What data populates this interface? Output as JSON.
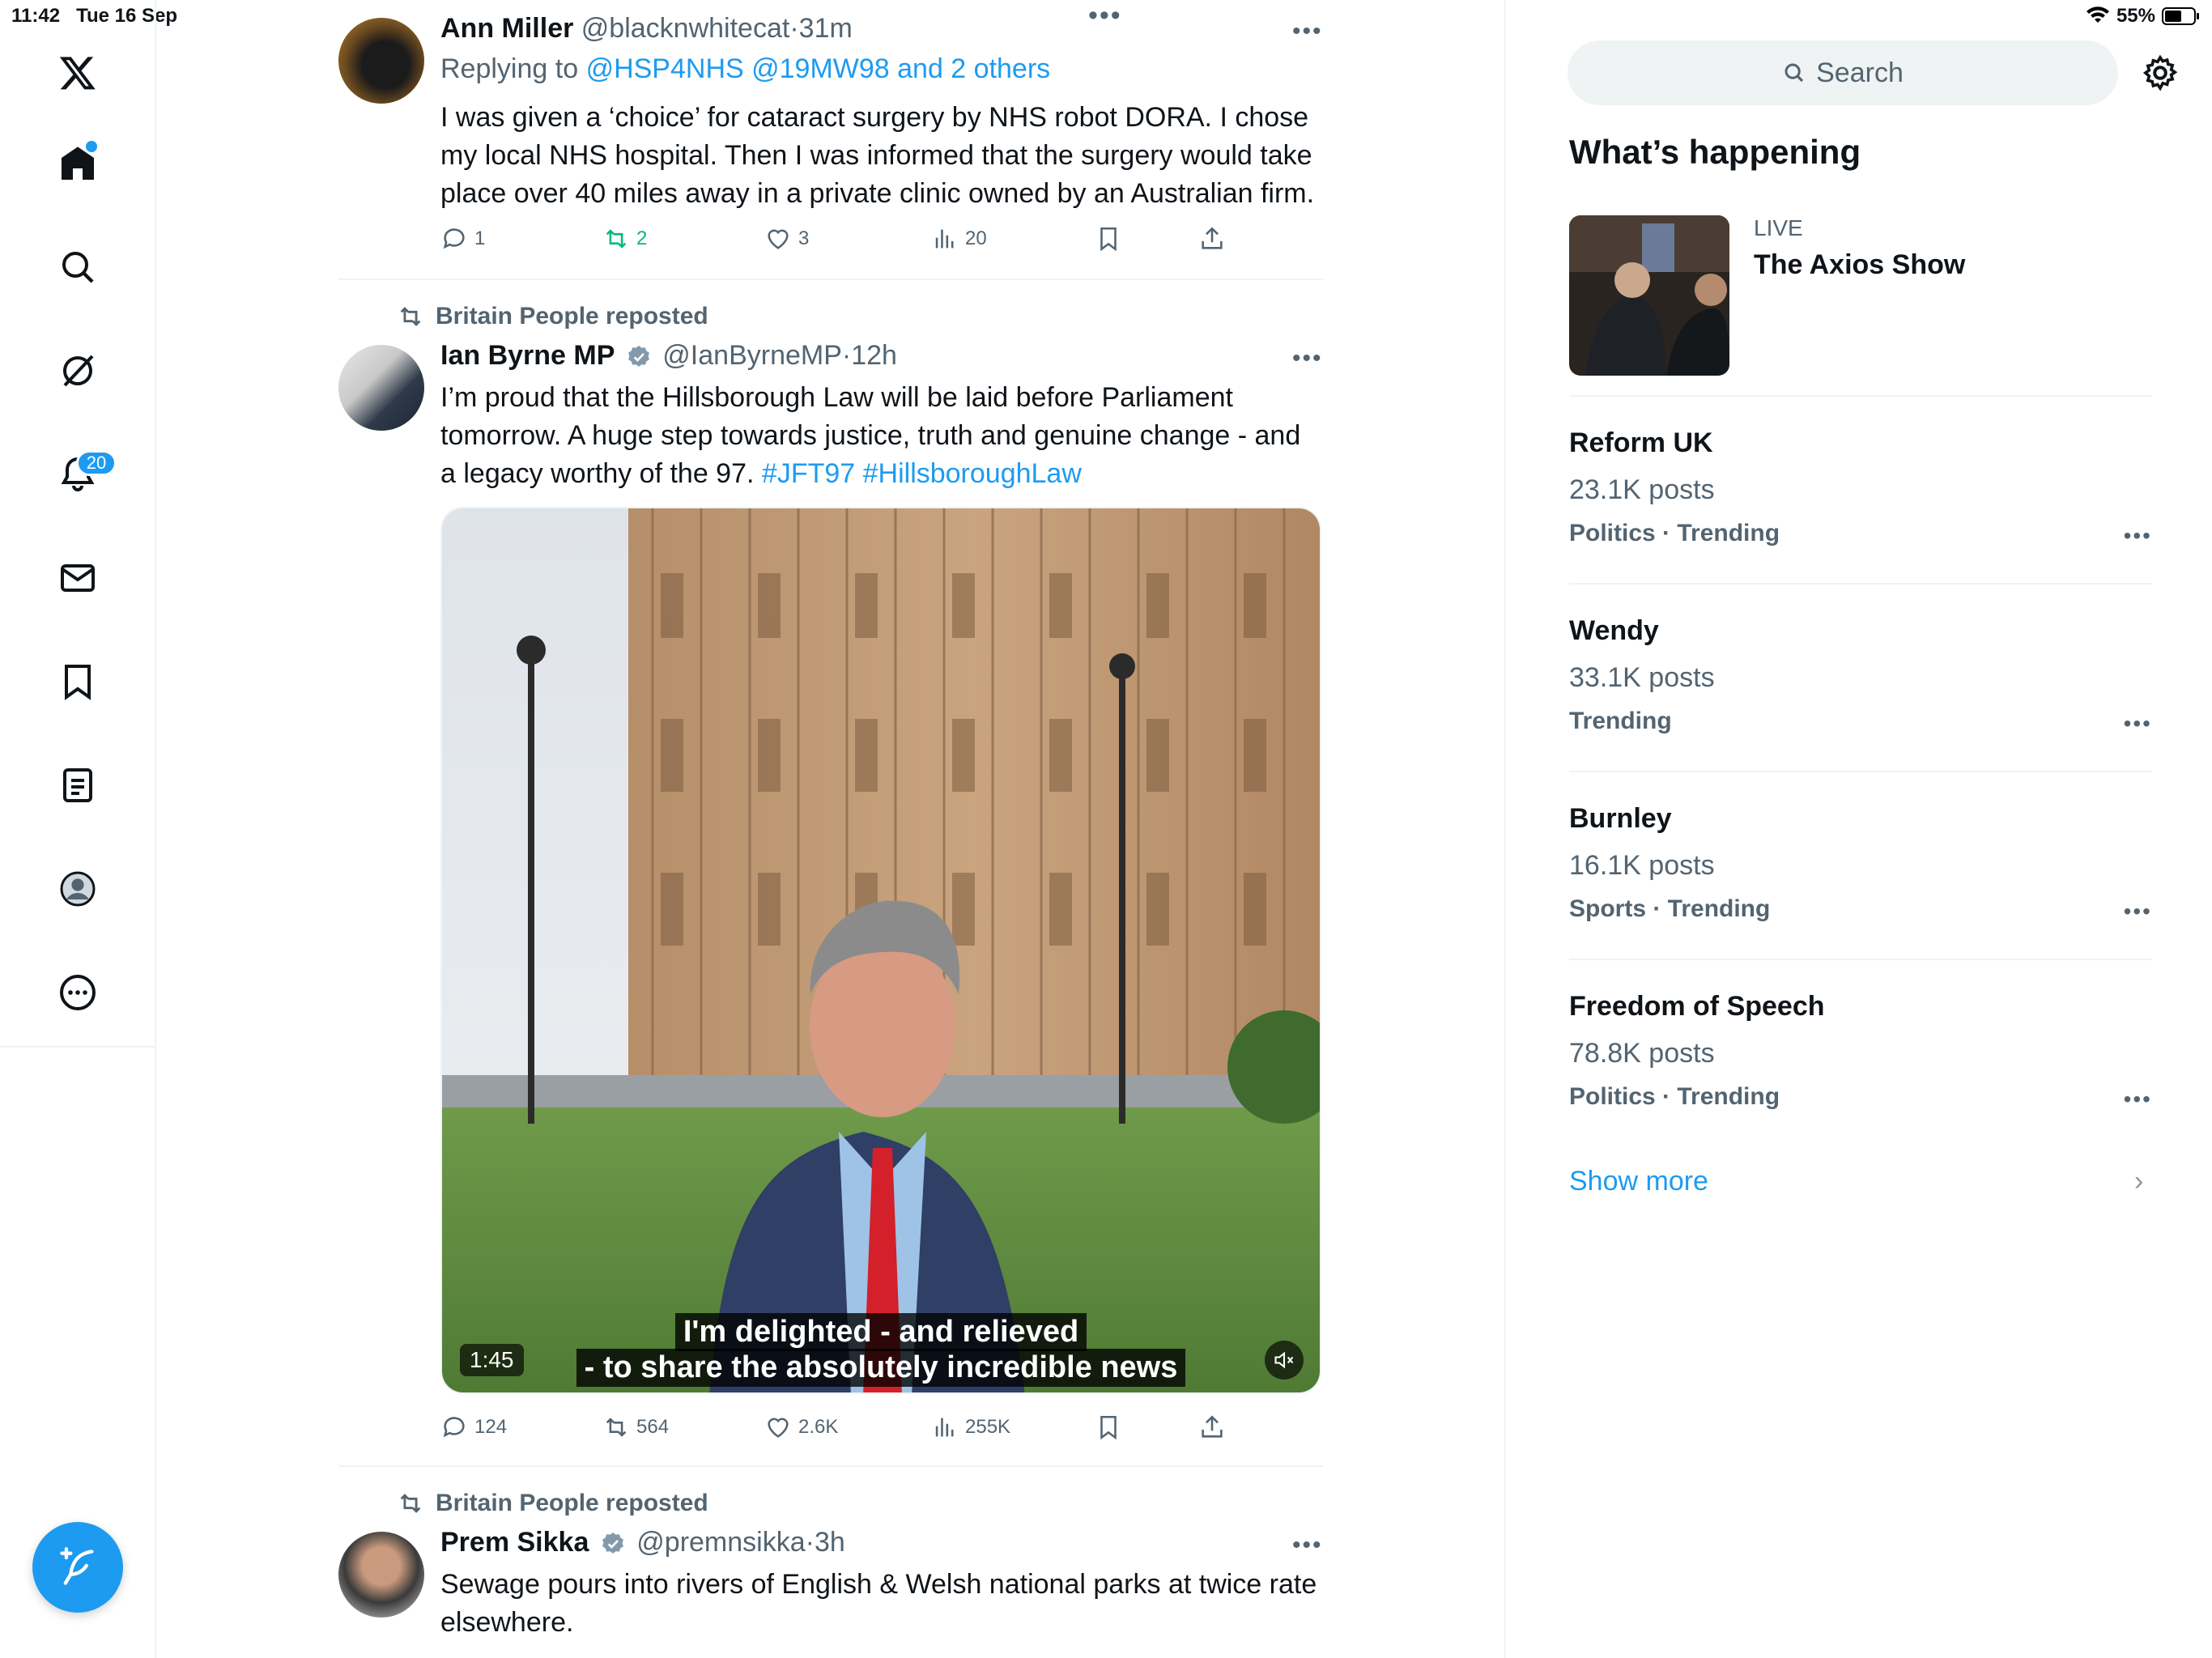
{
  "status_bar": {
    "time": "11:42",
    "date": "Tue 16 Sep",
    "battery": "55%"
  },
  "nav": {
    "notifications_badge": "20"
  },
  "tweets": [
    {
      "name": "Ann Miller",
      "handle": "@blacknwhitecat",
      "time": "31m",
      "replying_prefix": "Replying to",
      "replying_to": "@HSP4NHS @19MW98 and 2 others",
      "text": "I was given a ‘choice’ for cataract surgery by NHS robot DORA. I chose my local NHS hospital. Then I was informed that the surgery would take place over 40 miles away in a private clinic owned by an Australian firm.",
      "replies": "1",
      "reposts": "2",
      "likes": "3",
      "views": "20"
    },
    {
      "reposted_by": "Britain People reposted",
      "name": "Ian Byrne MP",
      "handle": "@IanByrneMP",
      "time": "12h",
      "text": "I’m proud that the Hillsborough Law will be laid before Parliament tomorrow. A huge step towards justice, truth and genuine change - and a legacy worthy of the 97. ",
      "hashtags": "#JFT97 #HillsboroughLaw",
      "video": {
        "caption_line1": "I'm delighted - and relieved",
        "caption_line2": "- to share the absolutely incredible news",
        "duration": "1:45"
      },
      "replies": "124",
      "reposts": "564",
      "likes": "2.6K",
      "views": "255K"
    },
    {
      "reposted_by": "Britain People reposted",
      "name": "Prem Sikka",
      "handle": "@premnsikka",
      "time": "3h",
      "text": "Sewage pours into rivers of English & Welsh national parks at twice rate elsewhere."
    }
  ],
  "right": {
    "search_placeholder": "Search",
    "section_title": "What’s happening",
    "live": {
      "label": "LIVE",
      "title": "The Axios Show"
    },
    "trends": [
      {
        "title": "Reform UK",
        "count": "23.1K posts",
        "meta": "Politics · Trending"
      },
      {
        "title": "Wendy",
        "count": "33.1K posts",
        "meta": "Trending"
      },
      {
        "title": "Burnley",
        "count": "16.1K posts",
        "meta": "Sports · Trending"
      },
      {
        "title": "Freedom of Speech",
        "count": "78.8K posts",
        "meta": "Politics · Trending"
      }
    ],
    "show_more": "Show more"
  },
  "colors": {
    "accent": "#1d9bf0",
    "repost_active": "#00ba7c",
    "text": "#0f1419",
    "muted": "#536471"
  },
  "icons": [
    "x-logo-icon",
    "home-icon",
    "search-icon",
    "grok-icon",
    "bell-icon",
    "mail-icon",
    "bookmark-icon",
    "lists-icon",
    "profile-icon",
    "more-icon",
    "compose-icon",
    "reply-icon",
    "repost-icon",
    "like-icon",
    "views-icon",
    "share-icon",
    "verified-icon",
    "settings-icon",
    "mute-icon",
    "chevron-right-icon"
  ]
}
